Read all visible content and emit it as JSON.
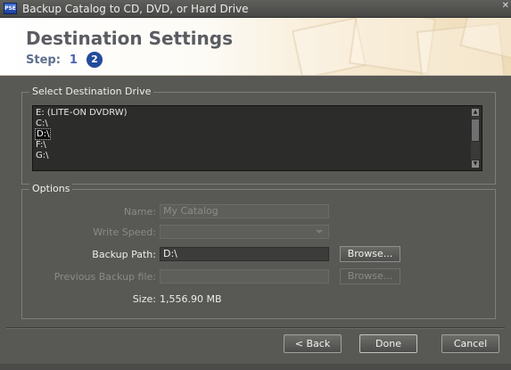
{
  "window": {
    "title": "Backup Catalog to CD, DVD, or Hard Drive",
    "app_icon": "PSE"
  },
  "header": {
    "title": "Destination Settings",
    "step_label": "Step:",
    "steps": [
      "1",
      "2"
    ],
    "current_step": "2"
  },
  "drive_group": {
    "legend": "Select Destination Drive",
    "drives": [
      "E: (LITE-ON DVDRW)",
      "C:\\",
      "D:\\",
      "F:\\",
      "G:\\"
    ],
    "selected": "D:\\"
  },
  "options": {
    "legend": "Options",
    "name_label": "Name:",
    "name_value": "My Catalog",
    "write_speed_label": "Write Speed:",
    "write_speed_value": "",
    "backup_path_label": "Backup Path:",
    "backup_path_value": "D:\\",
    "previous_backup_label": "Previous Backup file:",
    "previous_backup_value": "",
    "browse_label": "Browse...",
    "size_label": "Size:",
    "size_value": "1,556.90 MB"
  },
  "footer": {
    "back_label": "< Back",
    "done_label": "Done",
    "cancel_label": "Cancel"
  }
}
